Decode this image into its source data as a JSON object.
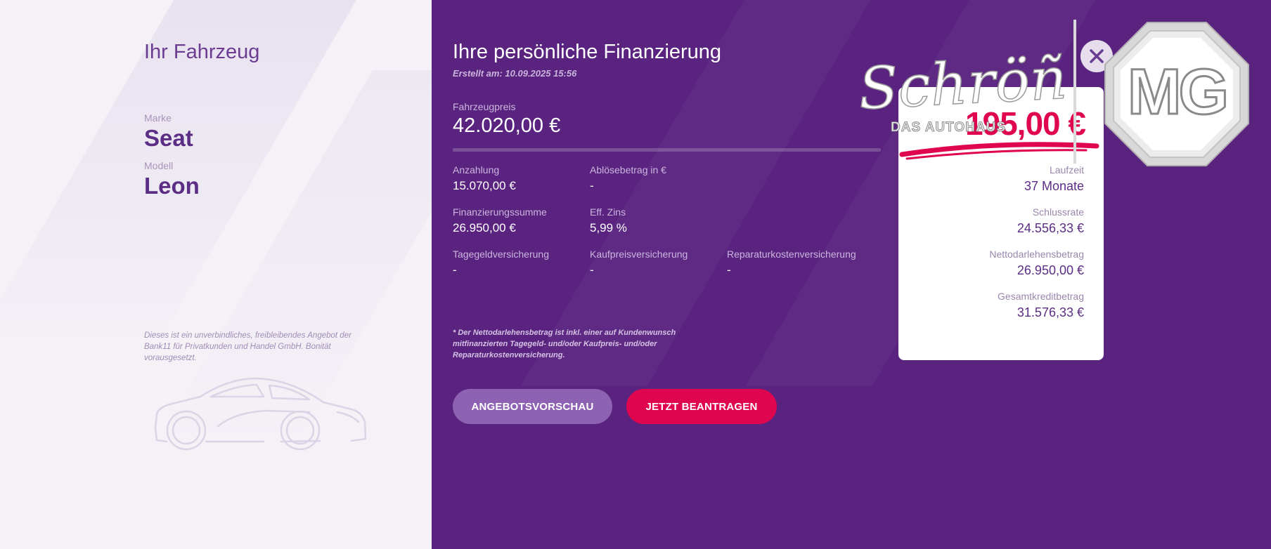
{
  "left": {
    "title": "Ihr Fahrzeug",
    "brand_label": "Marke",
    "brand_value": "Seat",
    "model_label": "Modell",
    "model_value": "Leon",
    "disclaimer": "Dieses ist ein unverbindliches, freibleibendes Angebot der Bank11 für Privatkunden und Handel GmbH. Bonität vorausgesetzt."
  },
  "financing": {
    "title": "Ihre persönliche Finanzierung",
    "created": "Erstellt am: 10.09.2025 15:56",
    "price_label": "Fahrzeugpreis",
    "price_value": "42.020,00 €",
    "fields": [
      {
        "label": "Anzahlung",
        "value": "15.070,00 €"
      },
      {
        "label": "Ablösebetrag in €",
        "value": "-"
      },
      {
        "label": "Finanzierungssumme",
        "value": "26.950,00 €"
      },
      {
        "label": "Eff. Zins",
        "value": "5,99 %"
      },
      {
        "label": "Tagegeldversicherung",
        "value": "-"
      },
      {
        "label": "Kaufpreisversicherung",
        "value": "-"
      },
      {
        "label": "Reparaturkostenversicherung",
        "value": "-"
      }
    ],
    "footnote": "* Der Nettodarlehensbetrag ist inkl. einer auf Kundenwunsch mitfinanzierten Tagegeld- und/oder Kaufpreis- und/oder Reparaturkostenversicherung.",
    "btn_preview": "ANGEBOTSVORSCHAU",
    "btn_apply": "JETZT BEANTRAGEN"
  },
  "card": {
    "rate": "195,00 €",
    "items": [
      {
        "label": "Laufzeit",
        "value": "37 Monate"
      },
      {
        "label": "Schlussrate",
        "value": "24.556,33 €"
      },
      {
        "label": "Nettodarlehensbetrag",
        "value": "26.950,00 €"
      },
      {
        "label": "Gesamtkreditbetrag",
        "value": "31.576,33 €"
      }
    ]
  },
  "logos": {
    "schroen_script": "Schröñ",
    "schroen_sub": "DAS AUTOHAUS",
    "mg": "MG"
  },
  "icons": {
    "close": "close-icon",
    "car": "car-outline-icon"
  },
  "colors": {
    "purple": "#5a237f",
    "accent": "#e0054f",
    "preview_button": "#8e62b2",
    "left_bg": "#f4f1f7"
  }
}
